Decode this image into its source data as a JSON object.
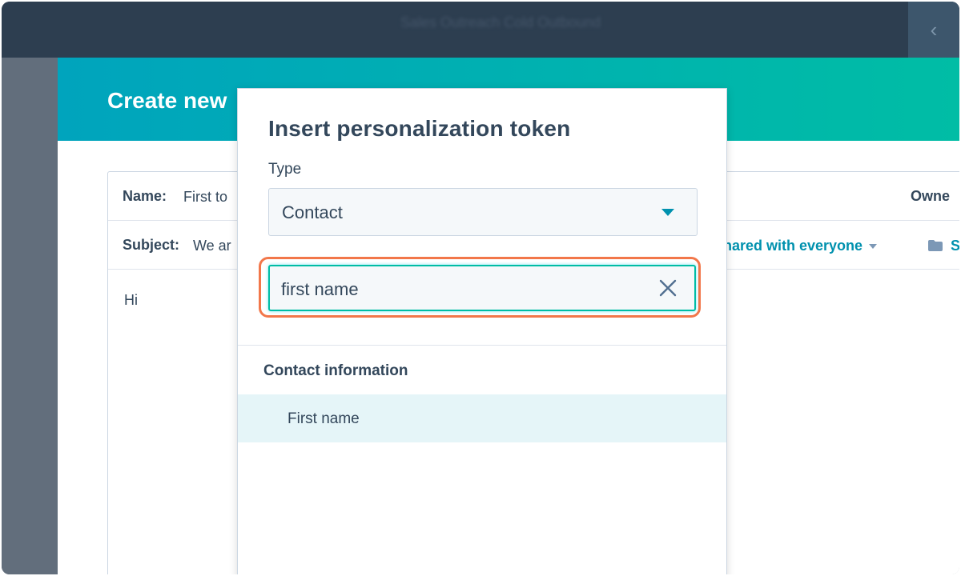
{
  "topbar": {
    "blurred_text": "Sales Outreach   Cold Outbound",
    "collapse_glyph": "‹"
  },
  "modal": {
    "title": "Create new"
  },
  "editor": {
    "name_label": "Name:",
    "name_value": "First to",
    "owner_label": "Owne",
    "subject_label": "Subject:",
    "subject_value": "We ar",
    "shared_label": "hared with everyone",
    "folder_label": "S",
    "body_text": "Hi"
  },
  "popover": {
    "title": "Insert personalization token",
    "type_label": "Type",
    "type_value": "Contact",
    "search_value": "first name",
    "section_heading": "Contact information",
    "results": [
      {
        "label": "First name"
      }
    ]
  },
  "colors": {
    "header_gradient_start": "#00a4bd",
    "header_gradient_end": "#00bda5",
    "highlight": "#f2774a",
    "link": "#0091ae"
  },
  "icons": {
    "dropdown": "chevron-down-icon",
    "clear": "close-icon",
    "folder": "folder-icon"
  }
}
